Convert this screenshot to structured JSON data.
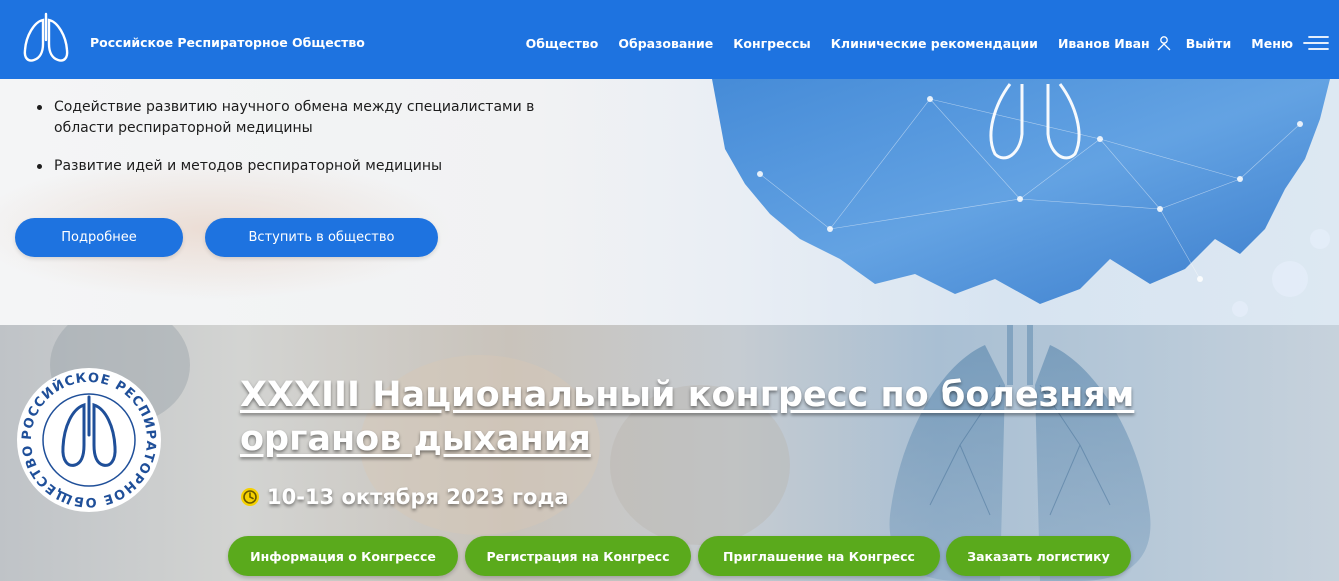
{
  "header": {
    "brand": "Российское Респираторное Общество",
    "nav": [
      "Общество",
      "Образование",
      "Конгрессы",
      "Клинические рекомендации"
    ],
    "user_name": "Иванов Иван",
    "logout": "Выйти",
    "menu": "Меню",
    "icons": {
      "logo": "lungs-logo",
      "user": "user-icon",
      "menu": "hamburger-icon"
    }
  },
  "hero": {
    "bullets": [
      "Содействие развитию научного обмена между специалистами в области респираторной медицины",
      "Развитие идей и методов респираторной медицины"
    ],
    "buttons": [
      "Подробнее",
      "Вступить в общество"
    ]
  },
  "congress": {
    "seal_text": "РОССИЙСКОЕ РЕСПИРАТОРНОЕ ОБЩЕСТВО",
    "title": "XXXIII Национальный конгресс по болезням органов дыхания",
    "date": "10-13 октября 2023 года",
    "buttons": [
      "Информация о Конгрессе",
      "Регистрация на Конгресс",
      "Приглашение на Конгресс",
      "Заказать логистику"
    ]
  },
  "colors": {
    "primary": "#1e73e0",
    "green": "#5aaa1c",
    "clock": "#f5d100"
  }
}
